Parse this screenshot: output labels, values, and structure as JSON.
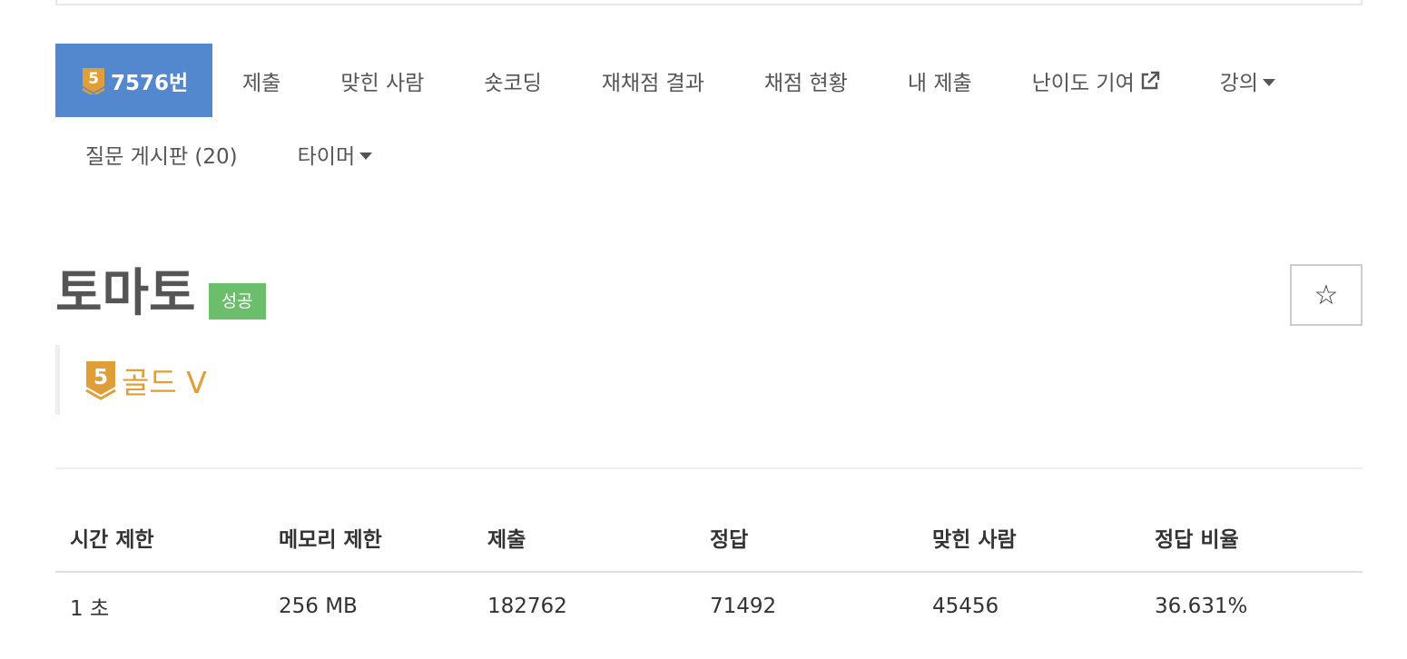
{
  "nav": {
    "problem_number": "7576번",
    "items": [
      {
        "label": "제출"
      },
      {
        "label": "맞힌 사람"
      },
      {
        "label": "숏코딩"
      },
      {
        "label": "재채점 결과"
      },
      {
        "label": "채점 현황"
      },
      {
        "label": "내 제출"
      },
      {
        "label": "난이도 기여"
      },
      {
        "label": "강의"
      }
    ],
    "items_row2": [
      {
        "label": "질문 게시판 (20)"
      },
      {
        "label": "타이머"
      }
    ]
  },
  "problem": {
    "title": "토마토",
    "status_label": "성공",
    "tier_digit": "5",
    "tier_text": "골드 V",
    "star": "☆"
  },
  "info_table": {
    "headers": [
      "시간 제한",
      "메모리 제한",
      "제출",
      "정답",
      "맞힌 사람",
      "정답 비율"
    ],
    "row": [
      "1 초",
      "256 MB",
      "182762",
      "71492",
      "45456",
      "36.631%"
    ]
  },
  "colors": {
    "accent": "#5388cf",
    "success": "#6cbe6c",
    "gold": "#e09e37"
  },
  "icons": [
    "gold-tier-icon",
    "external-link-icon",
    "caret-down-icon",
    "star-icon"
  ]
}
